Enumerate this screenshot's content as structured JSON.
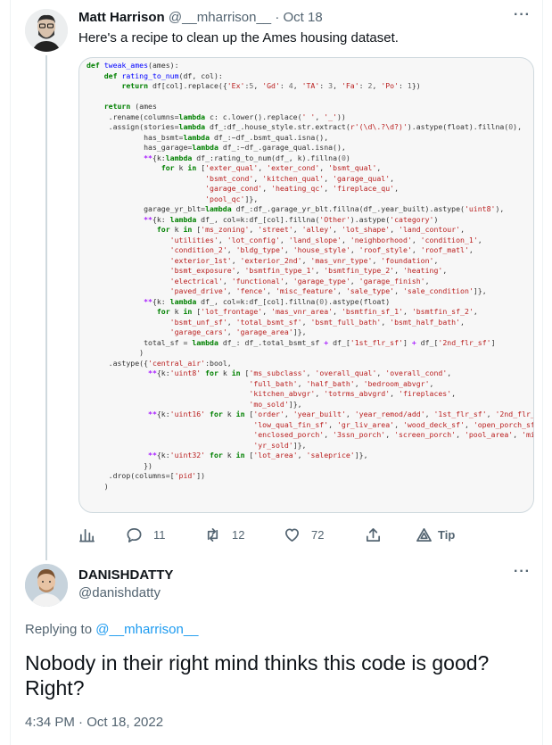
{
  "parent_tweet": {
    "author_name": "Matt Harrison",
    "author_handle": "@__mharrison__",
    "separator": "·",
    "date": "Oct 18",
    "text": "Here's a recipe to clean up the Ames housing dataset.",
    "stats": {
      "replies": "11",
      "retweets": "12",
      "likes": "72",
      "tip_label": "Tip"
    }
  },
  "reply_tweet": {
    "author_name": "DANISHDATTY",
    "author_handle": "@danishdatty",
    "replying_prefix": "Replying to",
    "replying_to": "@__mharrison__",
    "text": "Nobody in their right mind thinks this code is good? Right?",
    "timestamp": "4:34 PM · Oct 18, 2022"
  },
  "icons": {
    "more": "more-horizontal-icon",
    "analytics": "bar-chart-icon",
    "reply": "speech-bubble-icon",
    "retweet": "retweet-arrows-icon",
    "like": "heart-icon",
    "share": "share-upload-icon",
    "tip": "tip-triangle-icon"
  },
  "colors": {
    "link": "#1d9bf0",
    "muted": "#536471",
    "text": "#0f1419",
    "border": "#cfd9de"
  }
}
